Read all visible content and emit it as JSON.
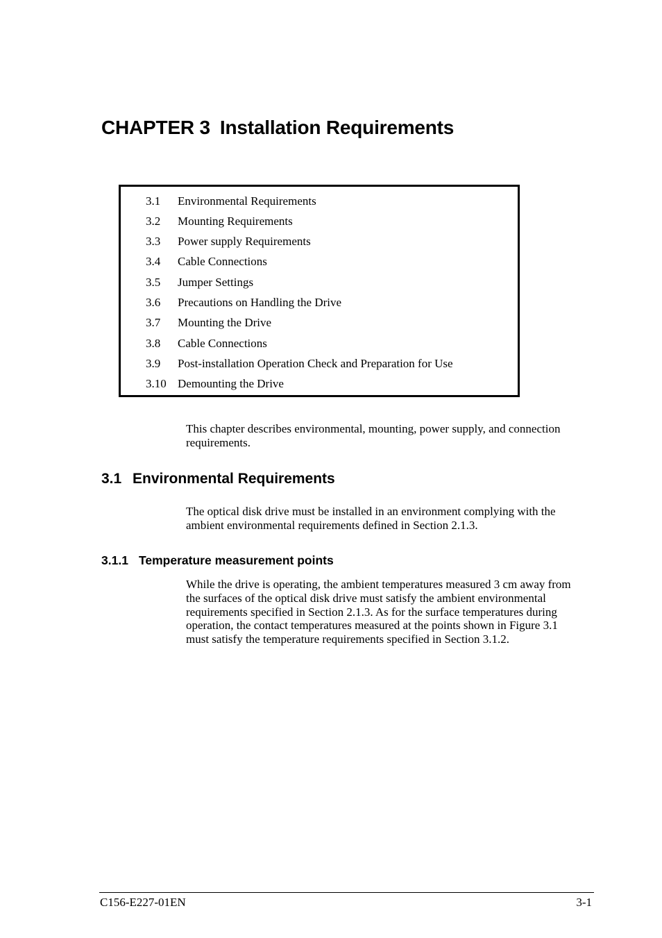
{
  "chapter": {
    "label": "CHAPTER 3",
    "title": "Installation Requirements"
  },
  "toc": [
    {
      "num": "3.1",
      "title": "Environmental Requirements"
    },
    {
      "num": "3.2",
      "title": "Mounting Requirements"
    },
    {
      "num": "3.3",
      "title": "Power supply Requirements"
    },
    {
      "num": "3.4",
      "title": "Cable Connections"
    },
    {
      "num": "3.5",
      "title": "Jumper Settings"
    },
    {
      "num": "3.6",
      "title": "Precautions on Handling the Drive"
    },
    {
      "num": "3.7",
      "title": "Mounting the Drive"
    },
    {
      "num": "3.8",
      "title": "Cable Connections"
    },
    {
      "num": "3.9",
      "title": "Post-installation Operation Check and Preparation for Use"
    },
    {
      "num": "3.10",
      "title": "Demounting the Drive"
    }
  ],
  "intro": {
    "lines": [
      "This chapter describes environmental, mounting, power supply, and connection",
      "requirements."
    ]
  },
  "section_3_1": {
    "num": "3.1",
    "title": "Environmental Requirements",
    "lines": [
      "The optical disk drive must be installed in an environment complying with the",
      "ambient environmental requirements defined in Section 2.1.3."
    ]
  },
  "section_3_1_1": {
    "num": "3.1.1",
    "title": "Temperature measurement points",
    "lines": [
      "While the drive is operating, the ambient temperatures measured 3 cm away from",
      "the surfaces of the optical disk drive must satisfy the ambient environmental",
      "requirements specified in Section 2.1.3.  As for the surface temperatures during",
      "operation, the contact temperatures measured at the points shown in Figure 3.1",
      "must satisfy the temperature requirements specified in Section 3.1.2."
    ]
  },
  "footer": {
    "doc_id": "C156-E227-01EN",
    "page": "3-1"
  }
}
